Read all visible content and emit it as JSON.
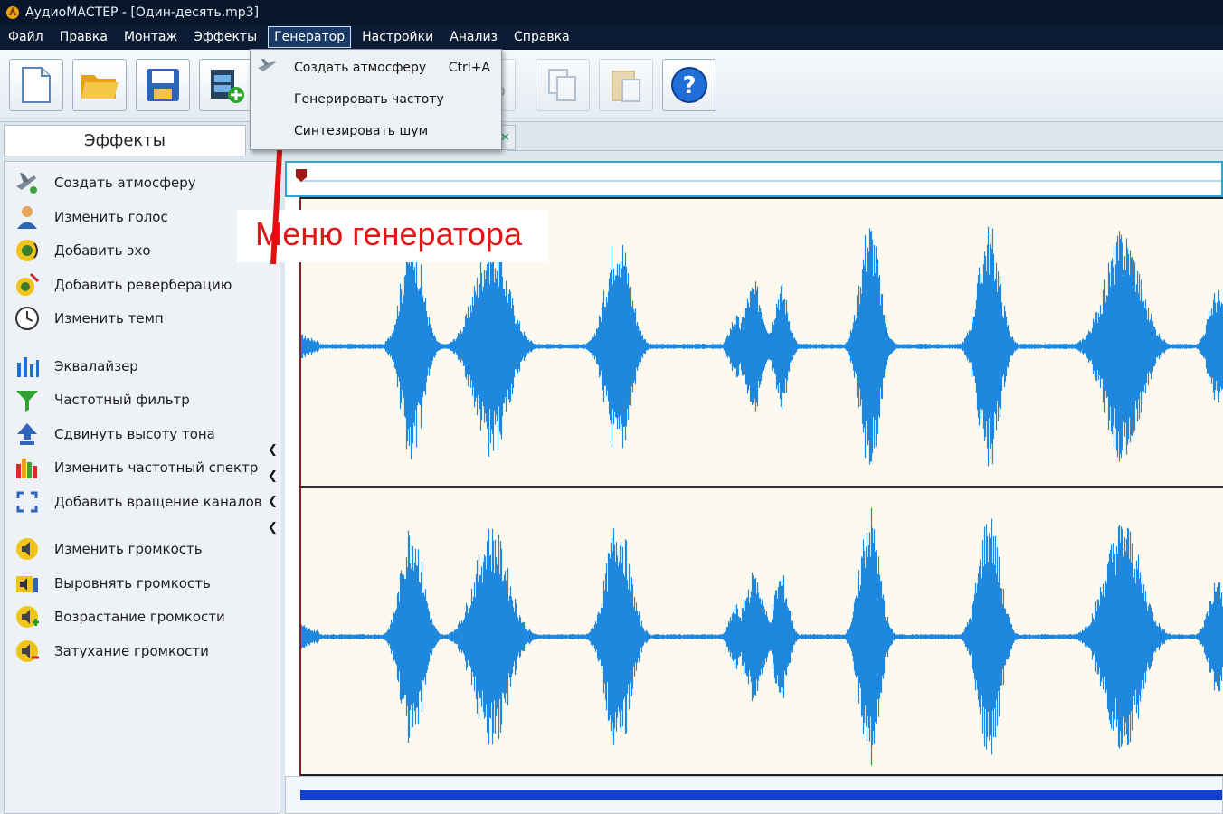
{
  "window": {
    "title": "АудиоМАСТЕР - [Один-десять.mp3]"
  },
  "menubar": {
    "items": [
      "Файл",
      "Правка",
      "Монтаж",
      "Эффекты",
      "Генератор",
      "Настройки",
      "Анализ",
      "Справка"
    ],
    "active": "Генератор"
  },
  "toolbar": {
    "buttons": [
      "new-file",
      "open-folder",
      "save",
      "add-video",
      "copy",
      "paste",
      "help"
    ]
  },
  "generator_menu": {
    "items": [
      {
        "label": "Создать атмосферу",
        "shortcut": "Ctrl+A"
      },
      {
        "label": "Генерировать частоту",
        "shortcut": ""
      },
      {
        "label": "Синтезировать шум",
        "shortcut": ""
      }
    ]
  },
  "effects_panel": {
    "title": "Эффекты",
    "items": [
      {
        "label": "Создать атмосферу",
        "icon": "airplane-icon"
      },
      {
        "label": "Изменить голос",
        "icon": "person-icon"
      },
      {
        "label": "Добавить эхо",
        "icon": "speaker-icon"
      },
      {
        "label": "Добавить реверберацию",
        "icon": "speaker-reverb-icon"
      },
      {
        "label": "Изменить темп",
        "icon": "clock-icon"
      },
      {
        "label": "Эквалайзер",
        "icon": "equalizer-icon"
      },
      {
        "label": "Частотный фильтр",
        "icon": "funnel-icon"
      },
      {
        "label": "Сдвинуть высоту тона",
        "icon": "pitch-up-icon"
      },
      {
        "label": "Изменить частотный спектр",
        "icon": "spectrum-icon"
      },
      {
        "label": "Добавить вращение каналов",
        "icon": "rotate-icon"
      },
      {
        "label": "Изменить громкость",
        "icon": "volume-icon"
      },
      {
        "label": "Выровнять громкость",
        "icon": "volume-level-icon"
      },
      {
        "label": "Возрастание громкости",
        "icon": "fade-in-icon"
      },
      {
        "label": "Затухание громкости",
        "icon": "fade-out-icon"
      }
    ]
  },
  "annotation": {
    "text": "Меню генератора"
  },
  "colors": {
    "waveform": "#1e88df",
    "background": "#fdf9ee",
    "menu_bar": "#0b1c34",
    "annotation": "#e01515"
  }
}
